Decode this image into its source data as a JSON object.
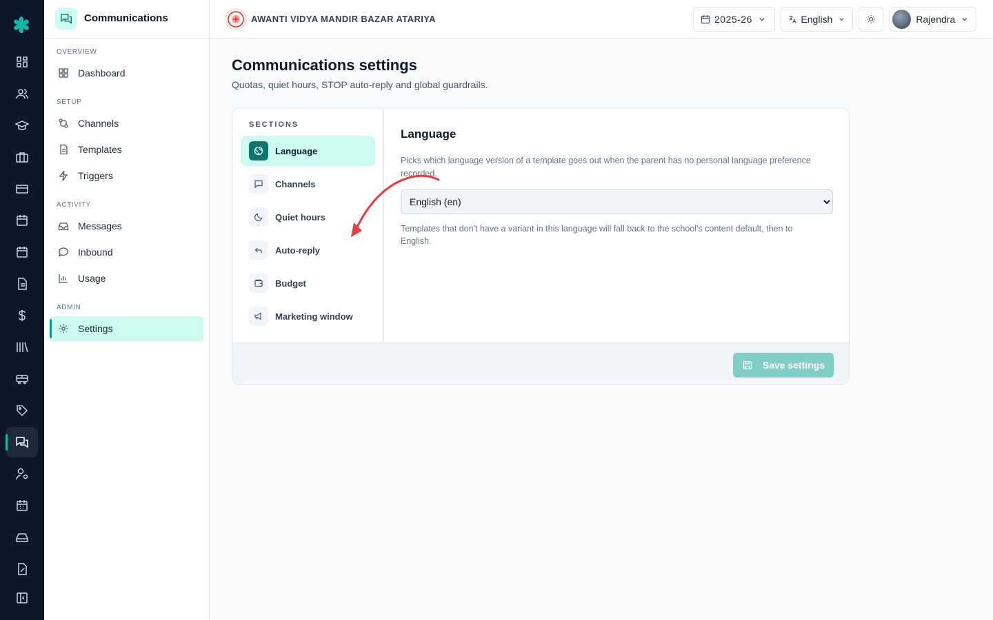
{
  "sidebar": {
    "app_title": "Communications",
    "sections": {
      "overview": "OVERVIEW",
      "setup": "SETUP",
      "activity": "ACTIVITY",
      "admin": "ADMIN"
    },
    "items": {
      "dashboard": "Dashboard",
      "channels": "Channels",
      "templates": "Templates",
      "triggers": "Triggers",
      "messages": "Messages",
      "inbound": "Inbound",
      "usage": "Usage",
      "settings": "Settings"
    },
    "active_item": "settings"
  },
  "topbar": {
    "school_name": "AWANTI VIDYA MANDIR BAZAR ATARIYA",
    "year": "2025-26",
    "language": "English",
    "user": "Rajendra"
  },
  "page": {
    "title": "Communications settings",
    "subtitle": "Quotas, quiet hours, STOP auto-reply and global guardrails."
  },
  "sections_nav": {
    "heading": "SECTIONS",
    "items": {
      "language": "Language",
      "channels": "Channels",
      "quiet_hours": "Quiet hours",
      "auto_reply": "Auto-reply",
      "budget": "Budget",
      "marketing_window": "Marketing window"
    },
    "active": "language"
  },
  "panel": {
    "title": "Language",
    "description": "Picks which language version of a template goes out when the parent has no personal language preference recorded.",
    "select_value": "English (en)",
    "note": "Templates that don't have a variant in this language will fall back to the school's content default, then to English."
  },
  "footer": {
    "save_label": "Save settings"
  },
  "colors": {
    "accent": "#0f766e",
    "accent_light": "#ccfbef",
    "rail": "#0f172a",
    "annotation_arrow": "#e53e3e"
  }
}
